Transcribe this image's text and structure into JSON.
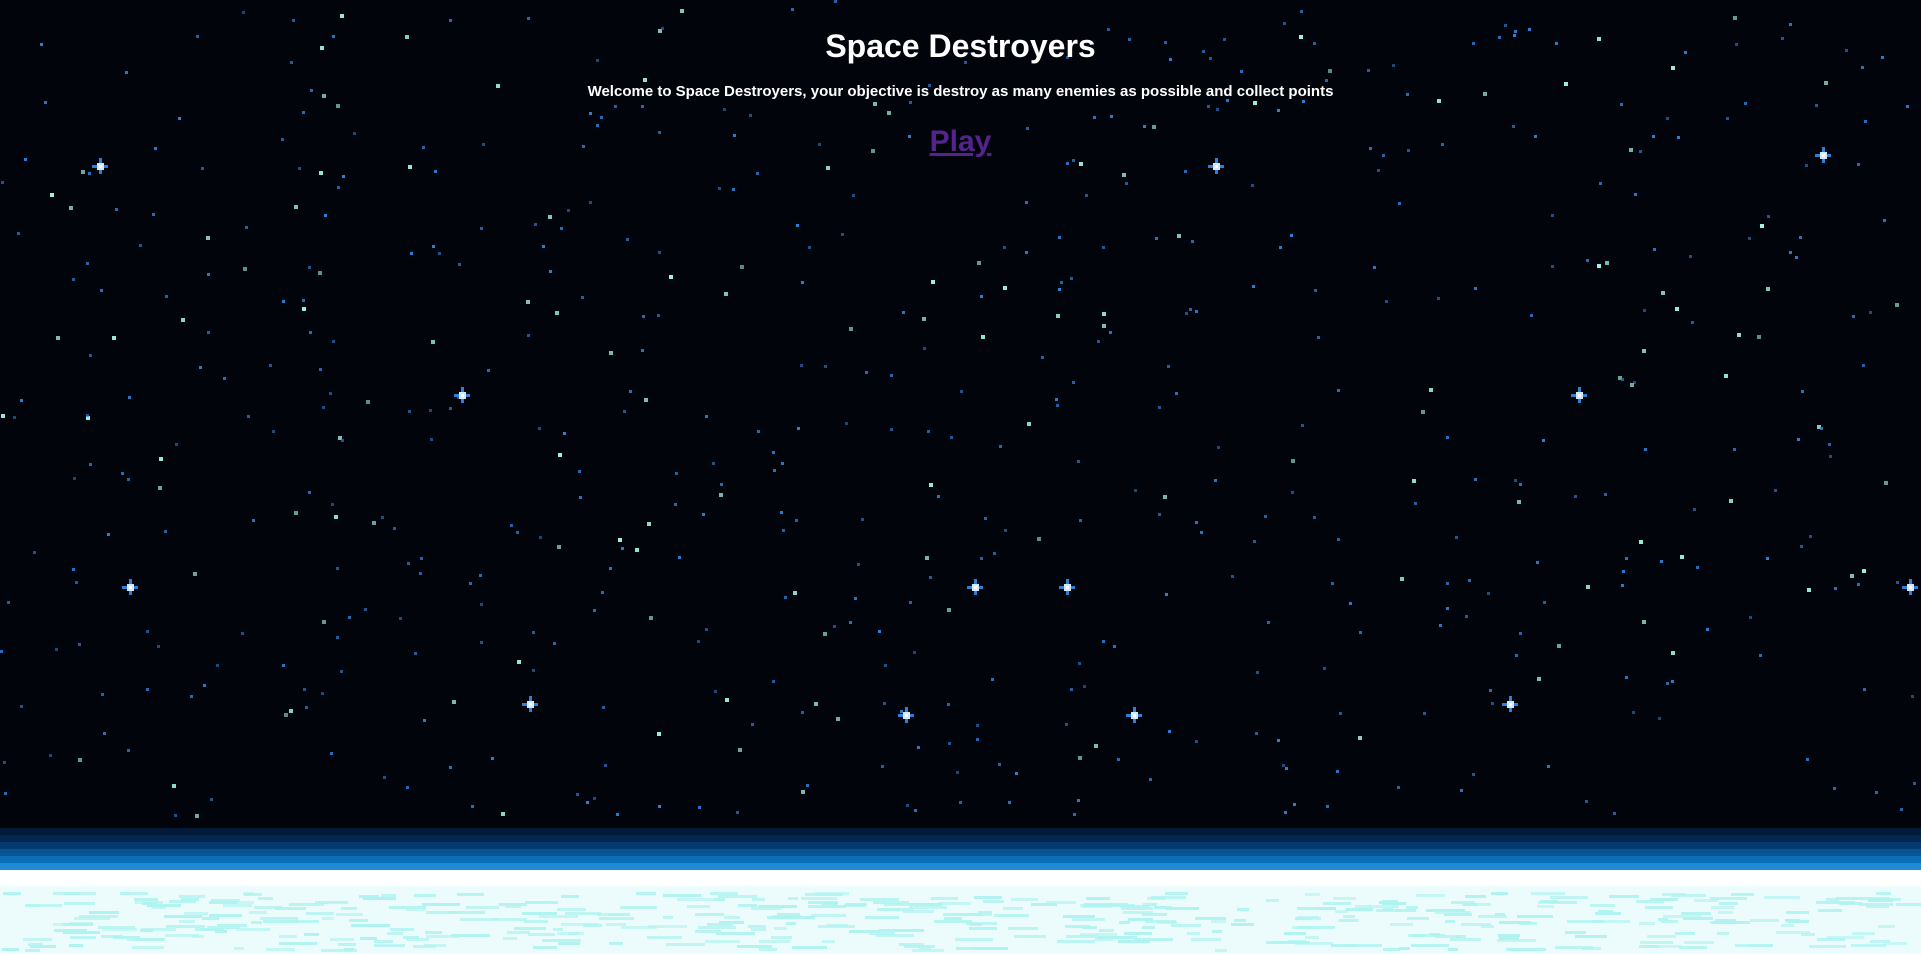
{
  "header": {
    "title": "Space Destroyers",
    "subtitle": "Welcome to Space Destroyers, your objective is destroy as many enemies as possible and collect points"
  },
  "actions": {
    "play_label": "Play"
  },
  "colors": {
    "space": "#01040a",
    "title_text": "#ffffff",
    "play_link": "#55238e",
    "star_blue": "#2f7fd6",
    "star_cyan": "#9ff3e6",
    "bright_star": "#cfe9ff",
    "horizon_bands": [
      "#021a38",
      "#03284f",
      "#053a6e",
      "#075394",
      "#0b6fb8",
      "#1f8ad6",
      "#ffffff"
    ],
    "surface": "#ecfbfb",
    "surface_marks": "#aff3f0"
  }
}
